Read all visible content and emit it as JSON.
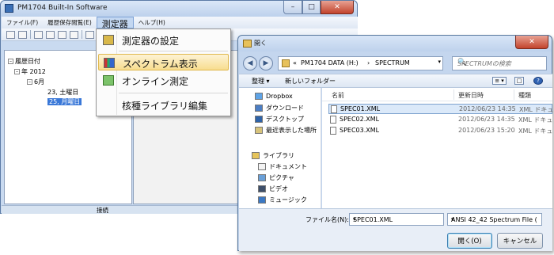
{
  "main_window": {
    "title": "PM1704 Built-In Software",
    "caption_buttons": {
      "minimize": "–",
      "maximize": "□",
      "close": "✕"
    },
    "menu": [
      "ファイル(F)",
      "履歴保存閲覧(E)",
      "測定器",
      "ヘルプ(H)"
    ],
    "tree": {
      "root": "履歴日付",
      "year": "年 2012",
      "month": "6月",
      "days": [
        "23, 土曜日",
        "25, 月曜日"
      ]
    },
    "status": "接続"
  },
  "dropdown": {
    "items": [
      {
        "label": "測定器の設定",
        "icon": "device-settings-icon"
      },
      {
        "label": "スペクトラム表示",
        "icon": "spectrum-chart-icon"
      },
      {
        "label": "オンライン測定",
        "icon": "online-refresh-icon"
      },
      {
        "label": "核種ライブラリ編集",
        "icon": ""
      }
    ],
    "highlighted_index": 1,
    "highlight_color": "#f8dd8f"
  },
  "open_dialog": {
    "title": "開く",
    "close": "✕",
    "address": {
      "sep": "«",
      "drive": "PM1704 DATA (H:)",
      "arrow": "›",
      "folder": "SPECTRUM",
      "drop": "▾"
    },
    "search_placeholder": "SPECTRUMの検索",
    "search_icon": "🔍",
    "nav_back": "◀",
    "nav_forward": "▶",
    "commands": {
      "organize": "整理 ▾",
      "new_folder": "新しいフォルダー",
      "view": "≡ ▾",
      "preview": "□",
      "help": "?"
    },
    "nav_pane": {
      "favorites": [
        "Dropbox",
        "ダウンロード",
        "デスクトップ",
        "最近表示した場所"
      ],
      "libraries_header": "ライブラリ",
      "libraries": [
        "ドキュメント",
        "ピクチャ",
        "ビデオ",
        "ミュージック"
      ]
    },
    "columns": {
      "name": "名前",
      "date": "更新日時",
      "type": "種類"
    },
    "files": [
      {
        "name": "SPEC01.XML",
        "date": "2012/06/23 14:35",
        "type": "XML ドキュ"
      },
      {
        "name": "SPEC02.XML",
        "date": "2012/06/23 14:35",
        "type": "XML ドキュ"
      },
      {
        "name": "SPEC03.XML",
        "date": "2012/06/23 15:20",
        "type": "XML ドキュ"
      }
    ],
    "selected_file_index": 0,
    "filename_label": "ファイル名(N):",
    "filename_value": "SPEC01.XML",
    "filter_value": "ANSI 42_42 Spectrum File (",
    "open_button": "開く(O)",
    "cancel_button": "キャンセル"
  }
}
